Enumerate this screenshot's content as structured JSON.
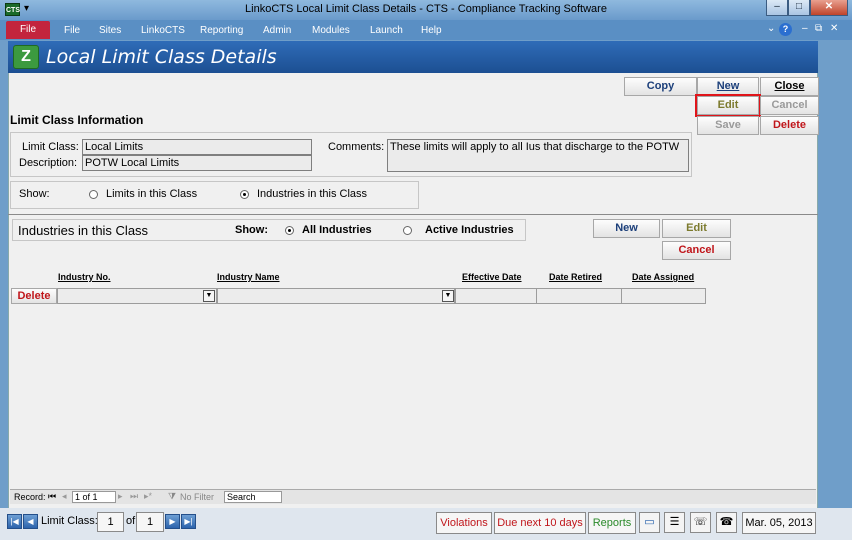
{
  "window": {
    "title": "LinkoCTS Local Limit Class Details  -  CTS - Compliance Tracking Software",
    "sys_icon": "CTS"
  },
  "menu": {
    "file": "File",
    "items": [
      "File",
      "Sites",
      "LinkoCTS",
      "Reporting",
      "Admin",
      "Modules",
      "Launch",
      "Help"
    ]
  },
  "header": {
    "title": "Local Limit Class Details",
    "logo": "Z"
  },
  "toolbar": {
    "copy": "Copy",
    "new": "New",
    "close": "Close",
    "edit": "Edit",
    "cancel": "Cancel",
    "save": "Save",
    "delete": "Delete"
  },
  "limit_class_info": {
    "section_title": "Limit Class Information",
    "limit_class_label": "Limit Class:",
    "limit_class_value": "Local Limits",
    "description_label": "Description:",
    "description_value": "POTW Local Limits",
    "comments_label": "Comments:",
    "comments_value": "These limits will apply to all Ius that discharge to the POTW"
  },
  "show_top": {
    "label": "Show:",
    "opt1": "Limits in this Class",
    "opt2": "Industries in this Class",
    "selected": "opt2"
  },
  "industries": {
    "title": "Industries in this Class",
    "show_label": "Show:",
    "opt_all": "All Industries",
    "opt_active": "Active Industries",
    "new": "New",
    "edit": "Edit",
    "cancel": "Cancel",
    "columns": [
      "Industry No.",
      "Industry Name",
      "Effective Date",
      "Date Retired",
      "Date Assigned"
    ],
    "row_delete": "Delete"
  },
  "subform_nav": {
    "record_label": "Record:",
    "record_value": "1 of 1",
    "filter": "No Filter",
    "search": "Search"
  },
  "bottom": {
    "limit_class_label": "Limit Class:",
    "current": "1",
    "of": "of",
    "total": "1",
    "violations": "Violations",
    "due": "Due next 10 days",
    "reports": "Reports",
    "date": "Mar. 05, 2013"
  },
  "colors": {
    "accent_red": "#c0161b",
    "header_blue": "#1c4f92",
    "reports_green": "#2a8a2a"
  }
}
